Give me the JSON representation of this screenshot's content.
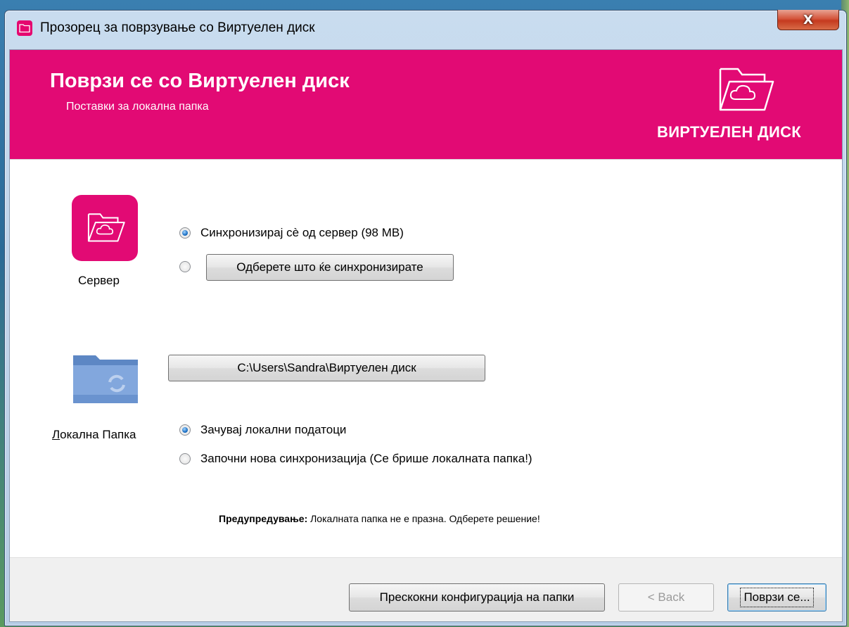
{
  "window": {
    "title": "Прозорец за поврзување со Виртуелен диск",
    "close_label": "X"
  },
  "banner": {
    "title": "Поврзи се со Виртуелен диск",
    "subtitle": "Поставки за локална папка",
    "brand_name": "ВИРТУЕЛЕН ДИСК",
    "color": "#e20a74"
  },
  "server": {
    "label": "Сервер",
    "options": [
      {
        "label": "Синхронизирај сè од сервер (98 MB)",
        "checked": true
      },
      {
        "label": "Одберете што ќе синхронизирате",
        "checked": false
      }
    ]
  },
  "local": {
    "label_first": "Л",
    "label_rest": "окална Папка",
    "path": "C:\\Users\\Sandra\\Виртуелен диск",
    "options": [
      {
        "label": "Зачувај локални податоци",
        "checked": true
      },
      {
        "label": "Започни нова синхронизација (Се брише локалната папка!)",
        "checked": false
      }
    ]
  },
  "warning": {
    "prefix": "Предупредување:",
    "text": " Локалната папка не е празна. Одберете решение!"
  },
  "footer": {
    "skip_label": "Прескокни конфигурација на папки",
    "back_label": "< Back",
    "connect_label": "Поврзи се..."
  }
}
